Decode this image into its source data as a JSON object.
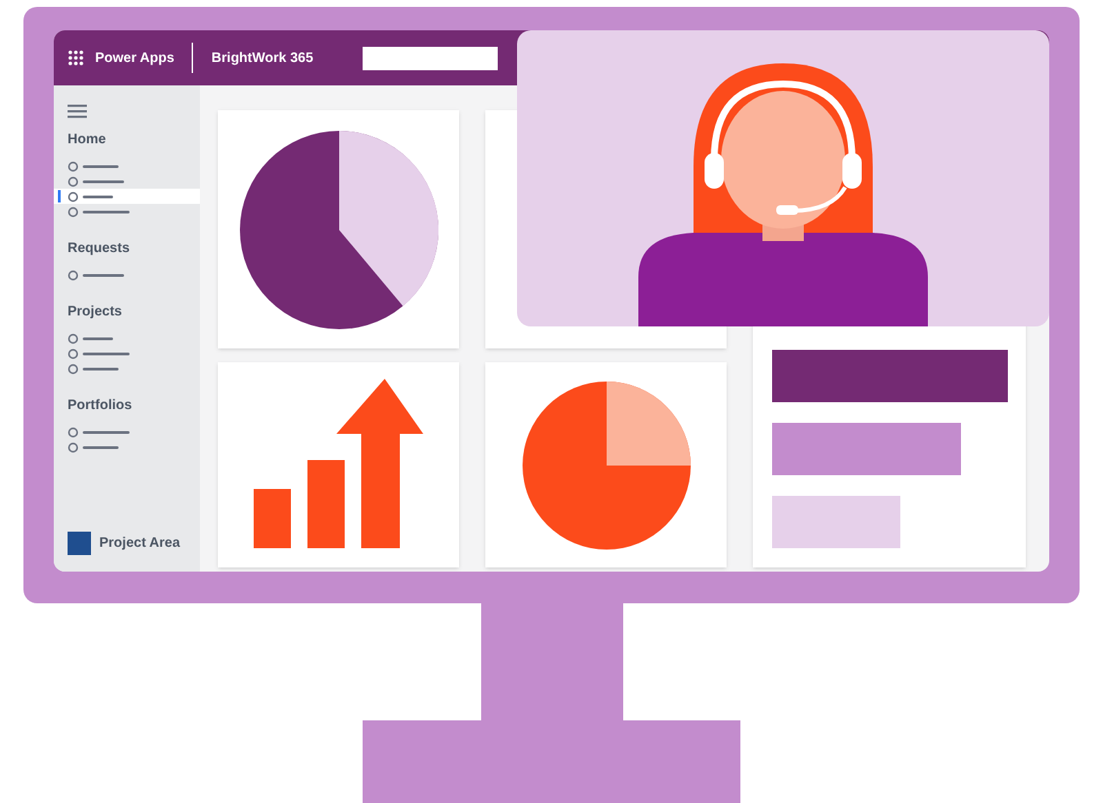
{
  "header": {
    "app_name": "Power Apps",
    "site_name": "BrightWork 365"
  },
  "sidebar": {
    "sections": [
      {
        "title": "Home",
        "items": [
          {
            "selected": false
          },
          {
            "selected": false
          },
          {
            "selected": true
          },
          {
            "selected": false
          }
        ]
      },
      {
        "title": "Requests",
        "items": [
          {
            "selected": false
          }
        ]
      },
      {
        "title": "Projects",
        "items": [
          {
            "selected": false
          },
          {
            "selected": false
          },
          {
            "selected": false
          }
        ]
      },
      {
        "title": "Portfolios",
        "items": [
          {
            "selected": false
          },
          {
            "selected": false
          }
        ]
      }
    ],
    "footer": {
      "label": "Project Area"
    }
  }
}
